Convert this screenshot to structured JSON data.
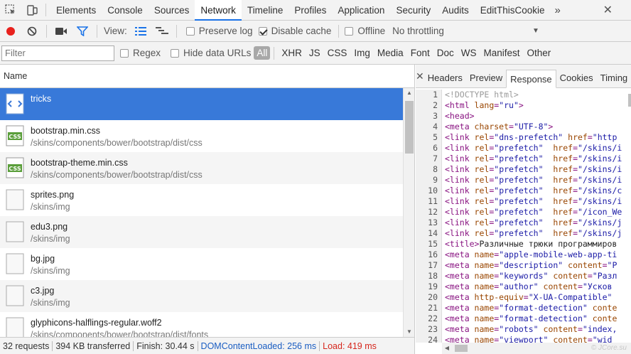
{
  "tabs": [
    {
      "label": "Elements"
    },
    {
      "label": "Console"
    },
    {
      "label": "Sources"
    },
    {
      "label": "Network"
    },
    {
      "label": "Timeline"
    },
    {
      "label": "Profiles"
    },
    {
      "label": "Application"
    },
    {
      "label": "Security"
    },
    {
      "label": "Audits"
    },
    {
      "label": "EditThisCookie"
    }
  ],
  "tabs_more": "»",
  "close_glyph": "✕",
  "toolbar": {
    "view_label": "View:",
    "preserve_log": "Preserve log",
    "disable_cache": "Disable cache",
    "offline": "Offline",
    "throttling": "No throttling",
    "throttle_arrow": "▼"
  },
  "filter": {
    "placeholder": "Filter",
    "regex": "Regex",
    "hide_data_urls": "Hide data URLs",
    "types": [
      "All",
      "XHR",
      "JS",
      "CSS",
      "Img",
      "Media",
      "Font",
      "Doc",
      "WS",
      "Manifest",
      "Other"
    ]
  },
  "list": {
    "column_name": "Name",
    "rows": [
      {
        "name": "tricks",
        "path": "",
        "icon": "html-doc-icon"
      },
      {
        "name": "bootstrap.min.css",
        "path": "/skins/components/bower/bootstrap/dist/css",
        "icon": "css-file-icon"
      },
      {
        "name": "bootstrap-theme.min.css",
        "path": "/skins/components/bower/bootstrap/dist/css",
        "icon": "css-file-icon"
      },
      {
        "name": "sprites.png",
        "path": "/skins/img",
        "icon": "image-file-icon"
      },
      {
        "name": "edu3.png",
        "path": "/skins/img",
        "icon": "image-file-icon"
      },
      {
        "name": "bg.jpg",
        "path": "/skins/img",
        "icon": "image-file-icon"
      },
      {
        "name": "c3.jpg",
        "path": "/skins/img",
        "icon": "image-file-icon"
      },
      {
        "name": "glyphicons-halflings-regular.woff2",
        "path": "/skins/components/bower/bootstrap/dist/fonts",
        "icon": "font-file-icon"
      }
    ]
  },
  "status": {
    "requests": "32 requests",
    "transferred": "394 KB transferred",
    "finish": "Finish: 30.44 s",
    "dom_content_loaded": "DOMContentLoaded: 256 ms",
    "load": "Load: 419 ms"
  },
  "detail_tabs": [
    "Headers",
    "Preview",
    "Response",
    "Cookies",
    "Timing"
  ],
  "response_lines": [
    [
      [
        "cm",
        "<!DOCTYPE html>"
      ]
    ],
    [
      [
        "tg",
        "<html "
      ],
      [
        "at",
        "lang"
      ],
      [
        "tg",
        "="
      ],
      [
        "av",
        "\"ru\""
      ],
      [
        "tg",
        ">"
      ]
    ],
    [
      [
        "tg",
        "<head>"
      ]
    ],
    [
      [
        "tg",
        "<meta "
      ],
      [
        "at",
        "charset"
      ],
      [
        "tg",
        "="
      ],
      [
        "av",
        "\"UTF-8\""
      ],
      [
        "tg",
        ">"
      ]
    ],
    [
      [
        "tg",
        "<link "
      ],
      [
        "at",
        "rel"
      ],
      [
        "tg",
        "="
      ],
      [
        "av",
        "\"dns-prefetch\""
      ],
      [
        "tg",
        " "
      ],
      [
        "at",
        "href"
      ],
      [
        "tg",
        "="
      ],
      [
        "av",
        "\"http"
      ]
    ],
    [
      [
        "tg",
        "<link "
      ],
      [
        "at",
        "rel"
      ],
      [
        "tg",
        "="
      ],
      [
        "av",
        "\"prefetch\""
      ],
      [
        "tg",
        "  "
      ],
      [
        "at",
        "href"
      ],
      [
        "tg",
        "="
      ],
      [
        "av",
        "\"/skins/i"
      ]
    ],
    [
      [
        "tg",
        "<link "
      ],
      [
        "at",
        "rel"
      ],
      [
        "tg",
        "="
      ],
      [
        "av",
        "\"prefetch\""
      ],
      [
        "tg",
        "  "
      ],
      [
        "at",
        "href"
      ],
      [
        "tg",
        "="
      ],
      [
        "av",
        "\"/skins/i"
      ]
    ],
    [
      [
        "tg",
        "<link "
      ],
      [
        "at",
        "rel"
      ],
      [
        "tg",
        "="
      ],
      [
        "av",
        "\"prefetch\""
      ],
      [
        "tg",
        "  "
      ],
      [
        "at",
        "href"
      ],
      [
        "tg",
        "="
      ],
      [
        "av",
        "\"/skins/i"
      ]
    ],
    [
      [
        "tg",
        "<link "
      ],
      [
        "at",
        "rel"
      ],
      [
        "tg",
        "="
      ],
      [
        "av",
        "\"prefetch\""
      ],
      [
        "tg",
        "  "
      ],
      [
        "at",
        "href"
      ],
      [
        "tg",
        "="
      ],
      [
        "av",
        "\"/skins/i"
      ]
    ],
    [
      [
        "tg",
        "<link "
      ],
      [
        "at",
        "rel"
      ],
      [
        "tg",
        "="
      ],
      [
        "av",
        "\"prefetch\""
      ],
      [
        "tg",
        "  "
      ],
      [
        "at",
        "href"
      ],
      [
        "tg",
        "="
      ],
      [
        "av",
        "\"/skins/c"
      ]
    ],
    [
      [
        "tg",
        "<link "
      ],
      [
        "at",
        "rel"
      ],
      [
        "tg",
        "="
      ],
      [
        "av",
        "\"prefetch\""
      ],
      [
        "tg",
        "  "
      ],
      [
        "at",
        "href"
      ],
      [
        "tg",
        "="
      ],
      [
        "av",
        "\"/skins/i"
      ]
    ],
    [
      [
        "tg",
        "<link "
      ],
      [
        "at",
        "rel"
      ],
      [
        "tg",
        "="
      ],
      [
        "av",
        "\"prefetch\""
      ],
      [
        "tg",
        "  "
      ],
      [
        "at",
        "href"
      ],
      [
        "tg",
        "="
      ],
      [
        "av",
        "\"/icon_We"
      ]
    ],
    [
      [
        "tg",
        "<link "
      ],
      [
        "at",
        "rel"
      ],
      [
        "tg",
        "="
      ],
      [
        "av",
        "\"prefetch\""
      ],
      [
        "tg",
        "  "
      ],
      [
        "at",
        "href"
      ],
      [
        "tg",
        "="
      ],
      [
        "av",
        "\"/skins/j"
      ]
    ],
    [
      [
        "tg",
        "<link "
      ],
      [
        "at",
        "rel"
      ],
      [
        "tg",
        "="
      ],
      [
        "av",
        "\"prefetch\""
      ],
      [
        "tg",
        "  "
      ],
      [
        "at",
        "href"
      ],
      [
        "tg",
        "="
      ],
      [
        "av",
        "\"/skins/j"
      ]
    ],
    [
      [
        "tg",
        "<title>"
      ],
      [
        "tx",
        "Различные трюки программиров"
      ]
    ],
    [
      [
        "tg",
        "<meta "
      ],
      [
        "at",
        "name"
      ],
      [
        "tg",
        "="
      ],
      [
        "av",
        "\"apple-mobile-web-app-ti"
      ]
    ],
    [
      [
        "tg",
        "<meta "
      ],
      [
        "at",
        "name"
      ],
      [
        "tg",
        "="
      ],
      [
        "av",
        "\"description\""
      ],
      [
        "tg",
        " "
      ],
      [
        "at",
        "content"
      ],
      [
        "tg",
        "="
      ],
      [
        "av",
        "\"P"
      ]
    ],
    [
      [
        "tg",
        "<meta "
      ],
      [
        "at",
        "name"
      ],
      [
        "tg",
        "="
      ],
      [
        "av",
        "\"keywords\""
      ],
      [
        "tg",
        " "
      ],
      [
        "at",
        "content"
      ],
      [
        "tg",
        "="
      ],
      [
        "av",
        "\"Разл"
      ]
    ],
    [
      [
        "tg",
        "<meta "
      ],
      [
        "at",
        "name"
      ],
      [
        "tg",
        "="
      ],
      [
        "av",
        "\"author\""
      ],
      [
        "tg",
        " "
      ],
      [
        "at",
        "content"
      ],
      [
        "tg",
        "="
      ],
      [
        "av",
        "\"Усков"
      ]
    ],
    [
      [
        "tg",
        "<meta "
      ],
      [
        "at",
        "http-equiv"
      ],
      [
        "tg",
        "="
      ],
      [
        "av",
        "\"X-UA-Compatible\""
      ],
      [
        "tg",
        " "
      ]
    ],
    [
      [
        "tg",
        "<meta "
      ],
      [
        "at",
        "name"
      ],
      [
        "tg",
        "="
      ],
      [
        "av",
        "\"format-detection\""
      ],
      [
        "tg",
        " "
      ],
      [
        "at",
        "conte"
      ]
    ],
    [
      [
        "tg",
        "<meta "
      ],
      [
        "at",
        "name"
      ],
      [
        "tg",
        "="
      ],
      [
        "av",
        "\"format-detection\""
      ],
      [
        "tg",
        " "
      ],
      [
        "at",
        "conte"
      ]
    ],
    [
      [
        "tg",
        "<meta "
      ],
      [
        "at",
        "name"
      ],
      [
        "tg",
        "="
      ],
      [
        "av",
        "\"robots\""
      ],
      [
        "tg",
        " "
      ],
      [
        "at",
        "content"
      ],
      [
        "tg",
        "="
      ],
      [
        "av",
        "\"index,"
      ]
    ],
    [
      [
        "tg",
        "<meta "
      ],
      [
        "at",
        "name"
      ],
      [
        "tg",
        "="
      ],
      [
        "av",
        "\"viewport\""
      ],
      [
        "tg",
        " "
      ],
      [
        "at",
        "content"
      ],
      [
        "tg",
        "="
      ],
      [
        "av",
        "\"wid"
      ]
    ]
  ],
  "watermark": "© JCore.su"
}
